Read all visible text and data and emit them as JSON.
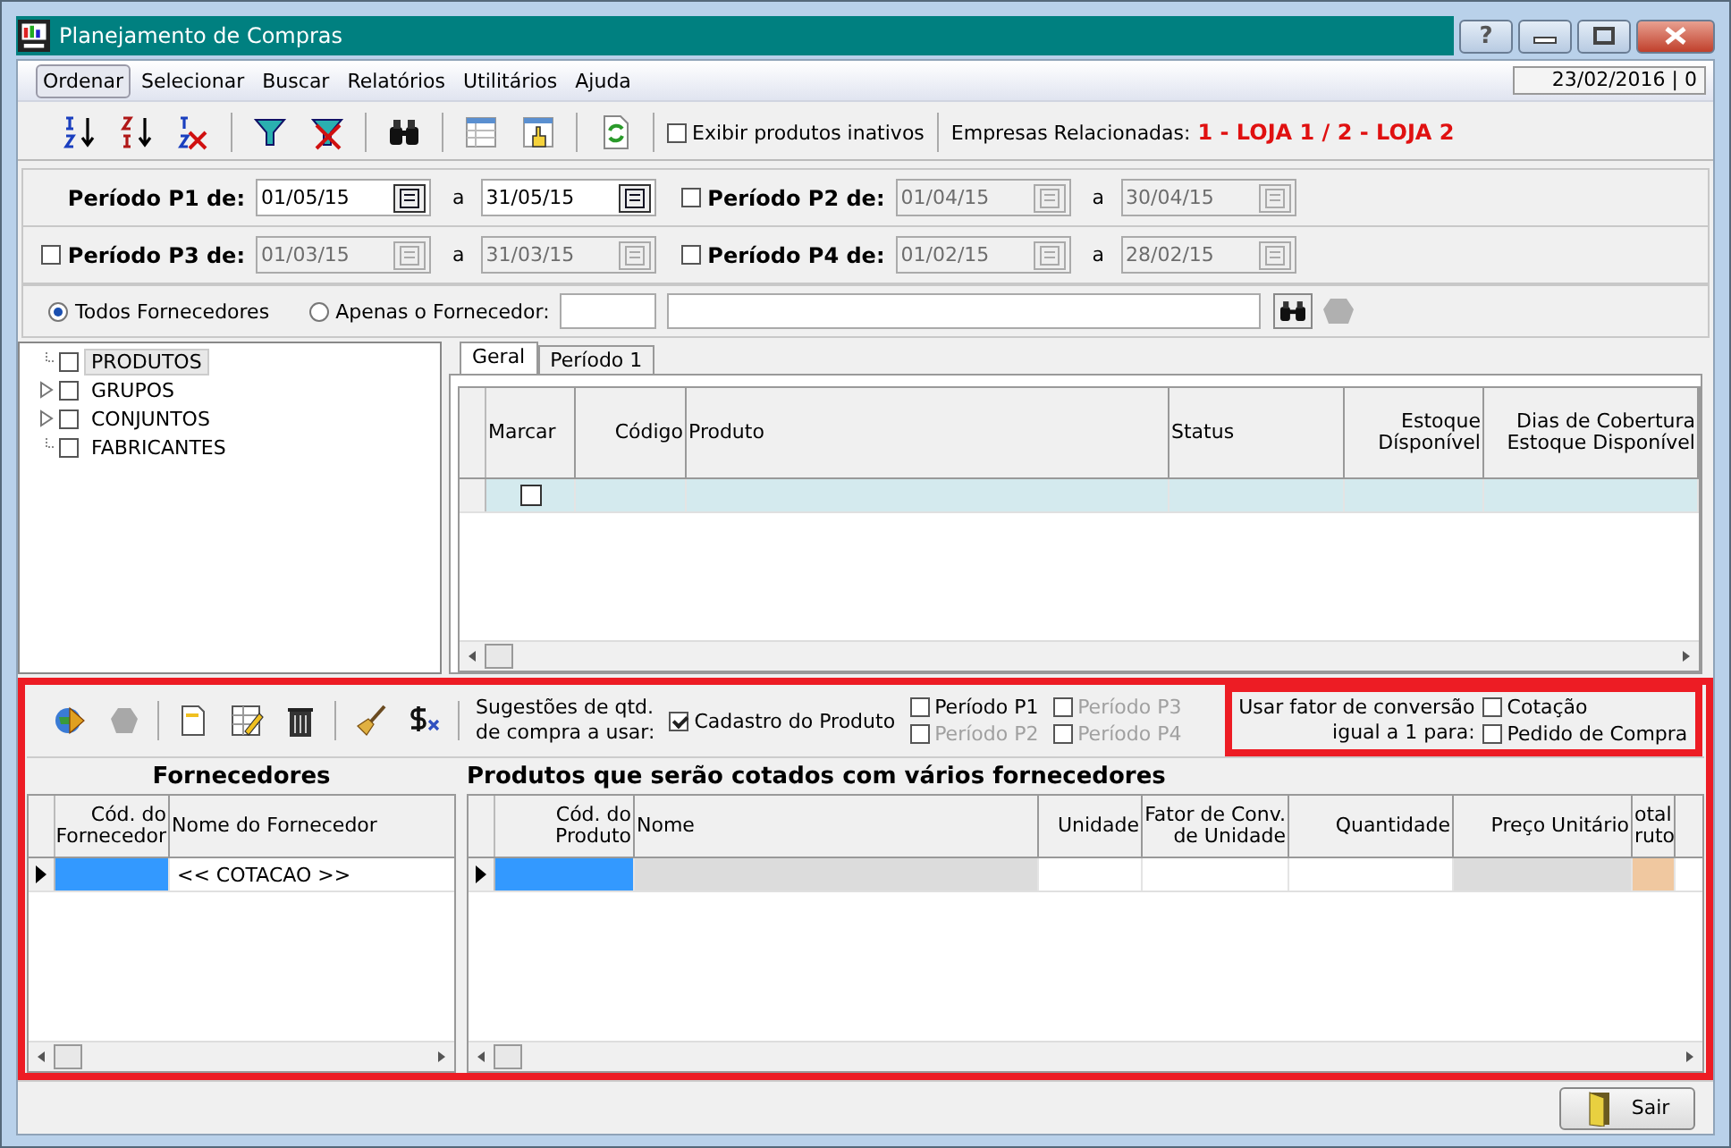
{
  "window": {
    "title": "Planejamento de Compras",
    "help": "?"
  },
  "menu": [
    {
      "label": "Ordenar",
      "selected": true
    },
    {
      "label": "Selecionar",
      "selected": false
    },
    {
      "label": "Buscar",
      "selected": false
    },
    {
      "label": "Relatórios",
      "selected": false
    },
    {
      "label": "Utilitários",
      "selected": false
    },
    {
      "label": "Ajuda",
      "selected": false
    }
  ],
  "date": "23/02/2016 | 0",
  "toolbar": {
    "show_inactive": {
      "label": "Exibir produtos inativos",
      "checked": false
    },
    "companies_label": "Empresas Relacionadas:",
    "companies": "1 - LOJA 1 / 2 - LOJA 2"
  },
  "periods": [
    {
      "label": "Período P1 de:",
      "kind": "fixed",
      "checked": true,
      "from": "01/05/15",
      "between": "a",
      "to": "31/05/15"
    },
    {
      "label": "Período P2 de:",
      "kind": "optional",
      "checked": false,
      "from": "01/04/15",
      "between": "a",
      "to": "30/04/15"
    },
    {
      "label": "Período P3 de:",
      "kind": "optional",
      "checked": false,
      "from": "01/03/15",
      "between": "a",
      "to": "31/03/15"
    },
    {
      "label": "Período P4 de:",
      "kind": "optional",
      "checked": false,
      "from": "01/02/15",
      "between": "a",
      "to": "28/02/15"
    }
  ],
  "supplier_filter": [
    {
      "label": "Todos Fornecedores",
      "selected": true
    },
    {
      "label": "Apenas o Fornecedor:",
      "selected": false
    }
  ],
  "tree": [
    {
      "label": "PRODUTOS",
      "kind": "leaf",
      "checked": false,
      "selected": true
    },
    {
      "label": "GRUPOS",
      "kind": "branch",
      "checked": false,
      "selected": false
    },
    {
      "label": "CONJUNTOS",
      "kind": "branch",
      "checked": false,
      "selected": false
    },
    {
      "label": "FABRICANTES",
      "kind": "leaf",
      "checked": false,
      "selected": false
    }
  ],
  "tabs": [
    {
      "label": "Geral",
      "selected": true
    },
    {
      "label": "Período 1",
      "selected": false
    }
  ],
  "products_grid": {
    "columns": [
      {
        "lines": [
          "Marcar"
        ]
      },
      {
        "lines": [
          "Código"
        ]
      },
      {
        "lines": [
          "Produto"
        ]
      },
      {
        "lines": [
          "Status"
        ]
      },
      {
        "lines": [
          "Estoque",
          "Dísponível"
        ]
      },
      {
        "lines": [
          "Dias de Cobertura",
          "Estoque Disponível"
        ]
      }
    ],
    "rows": [
      {
        "checked": false
      }
    ]
  },
  "suggestions": {
    "label": [
      "Sugestões de qtd.",
      "de compra a usar:"
    ],
    "options": [
      {
        "label": "Cadastro do Produto",
        "checked": true,
        "disabled": false
      },
      {
        "label": "Período P1",
        "checked": false,
        "disabled": false
      },
      {
        "label": "Período P2",
        "checked": false,
        "disabled": true
      },
      {
        "label": "Período P3",
        "checked": false,
        "disabled": true
      },
      {
        "label": "Período P4",
        "checked": false,
        "disabled": true
      }
    ]
  },
  "conversion": {
    "label": [
      "Usar fator de conversão",
      "igual a 1 para:"
    ],
    "options": [
      {
        "label": "Cotação",
        "checked": false
      },
      {
        "label": "Pedido de Compra",
        "checked": false
      }
    ]
  },
  "suppliers_grid": {
    "title": "Fornecedores",
    "columns": [
      {
        "lines": [
          "Cód. do",
          "Fornecedor"
        ]
      },
      {
        "lines": [
          "Nome do Fornecedor"
        ]
      }
    ],
    "rows": [
      {
        "name": "<< COTACAO >>"
      }
    ]
  },
  "quote_grid": {
    "title": "Produtos que serão cotados com vários fornecedores",
    "columns": [
      {
        "lines": [
          "Cód. do",
          "Produto"
        ]
      },
      {
        "lines": [
          "Nome"
        ]
      },
      {
        "lines": [
          "Unidade"
        ]
      },
      {
        "lines": [
          "Fator de Conv.",
          "de Unidade"
        ]
      },
      {
        "lines": [
          "Quantidade"
        ]
      },
      {
        "lines": [
          "Preço Unitário"
        ]
      },
      {
        "lines": [
          "otal",
          "ruto"
        ]
      }
    ]
  },
  "exit_button": "Sair"
}
